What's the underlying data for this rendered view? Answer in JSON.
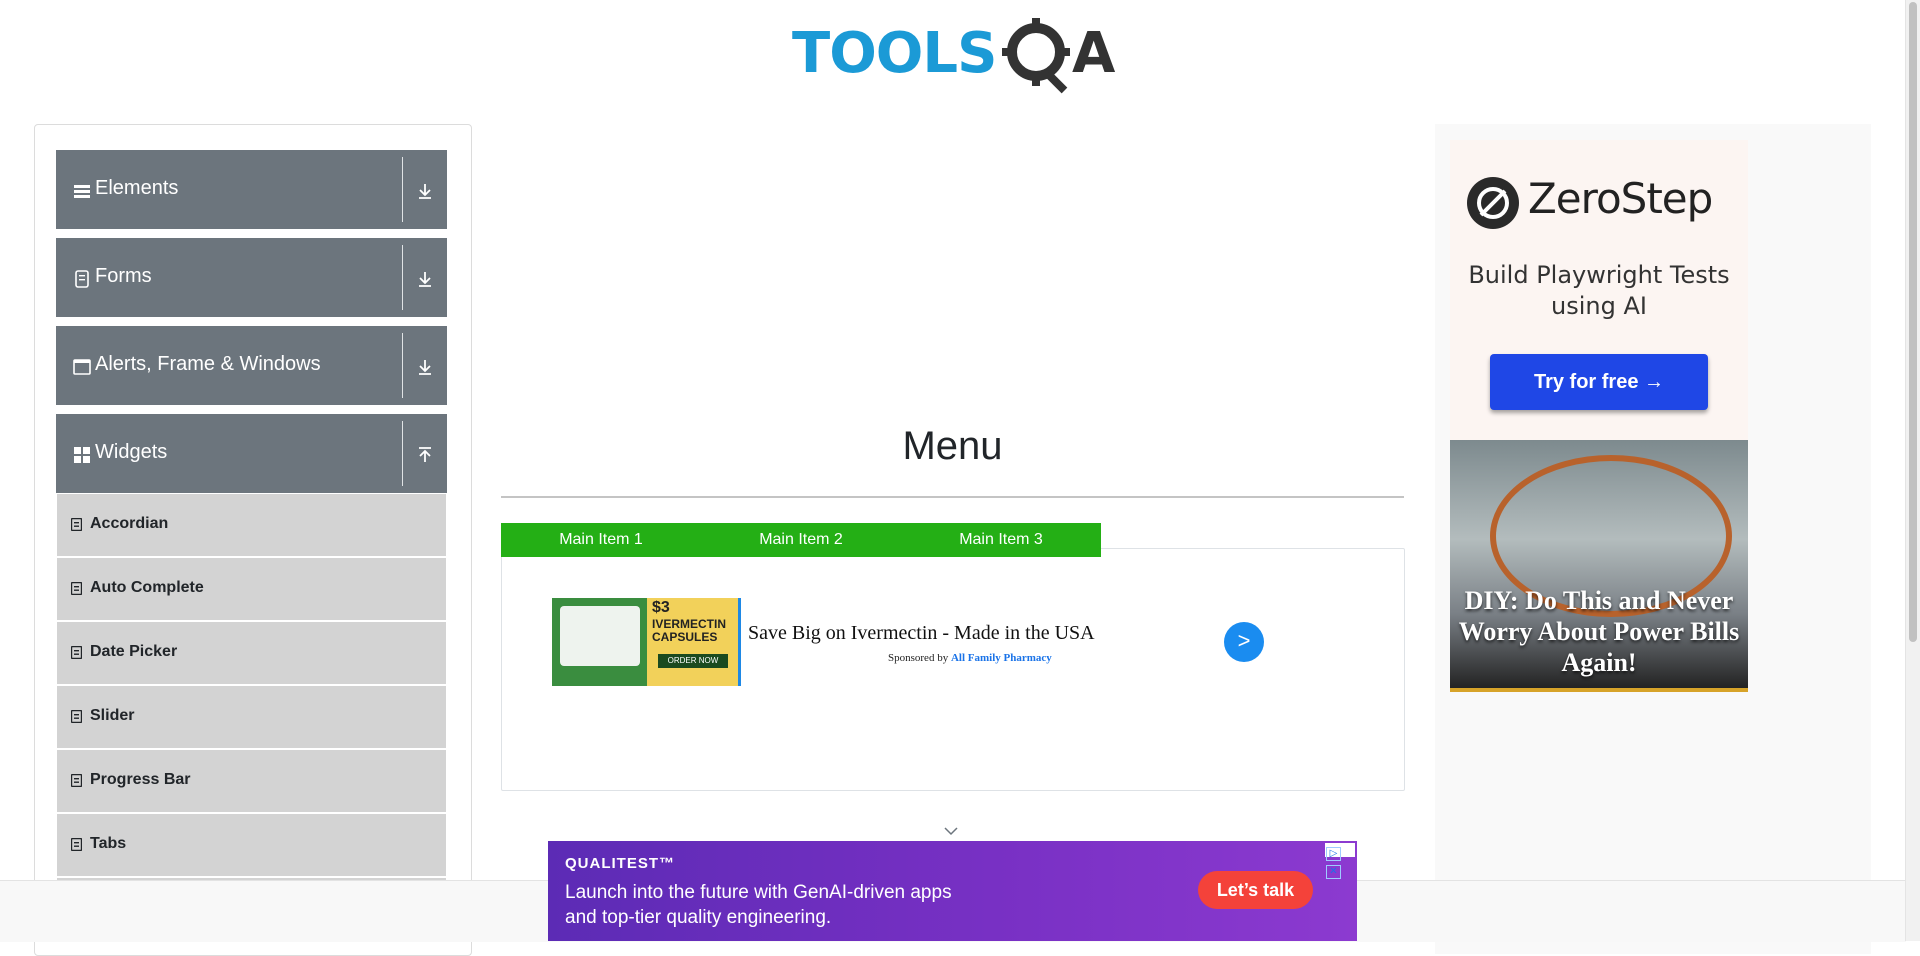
{
  "header": {
    "logo_text": "TOOLS",
    "logo_suffix": "A"
  },
  "sidebar": {
    "groups": [
      {
        "label": "Elements",
        "icon": "hamburger-icon",
        "expanded": false
      },
      {
        "label": "Forms",
        "icon": "document-icon",
        "expanded": false
      },
      {
        "label": "Alerts, Frame & Windows",
        "icon": "window-icon",
        "expanded": false
      },
      {
        "label": "Widgets",
        "icon": "widgets-icon",
        "expanded": true
      }
    ],
    "widget_items": [
      "Accordian",
      "Auto Complete",
      "Date Picker",
      "Slider",
      "Progress Bar",
      "Tabs"
    ]
  },
  "main": {
    "title": "Menu",
    "nav_items": [
      "Main Item 1",
      "Main Item 2",
      "Main Item 3"
    ],
    "nav_color": "#24af15"
  },
  "ad_inline": {
    "headline": "Save Big on Ivermectin - Made in the USA",
    "sponsored_by": "Sponsored by",
    "sponsor": "All Family Pharmacy",
    "image_price": "$3",
    "image_caption": "IVERMECTIN CAPSULES",
    "image_order": "ORDER NOW",
    "go_label": ">"
  },
  "ad_right": {
    "brand": "ZeroStep",
    "tagline": "Build Playwright Tests using AI",
    "cta": "Try for free →",
    "diy_text": "DIY: Do This and Never Worry About Power Bills Again!"
  },
  "ad_bottom": {
    "brand": "QUALITEST™",
    "copy": "Launch into the future with GenAI-driven apps and top-tier quality engineering.",
    "cta": "Let’s talk"
  }
}
